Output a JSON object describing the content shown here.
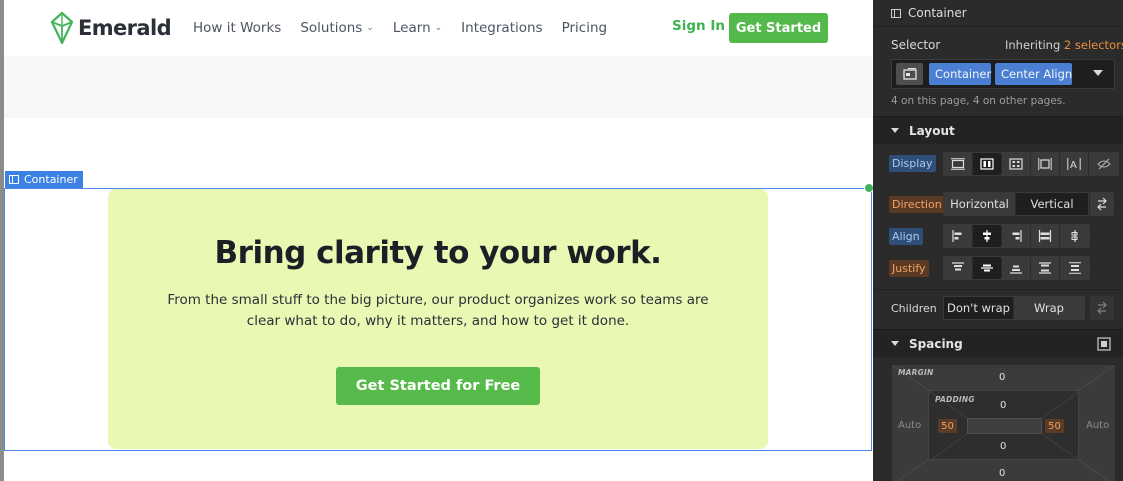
{
  "site": {
    "logo_text": "Emerald",
    "nav": [
      "How it Works",
      "Solutions",
      "Learn",
      "Integrations",
      "Pricing"
    ],
    "nav_has_dropdown": [
      false,
      true,
      true,
      false,
      false
    ],
    "sign_in": "Sign In",
    "get_started": "Get Started",
    "selection_tag": "Container",
    "hero": {
      "title": "Bring clarity to your work.",
      "subtitle": "From the small stuff to the big picture, our product organizes work so teams are clear what to do, why it matters, and how to get it done.",
      "cta": "Get Started for Free"
    }
  },
  "panel": {
    "header": "Container",
    "selector_label": "Selector",
    "inheriting_prefix": "Inheriting",
    "inheriting_link": "2 selectors",
    "chips": [
      "Container",
      "Center Align"
    ],
    "usage_note": "4 on this page, 4 on other pages.",
    "layout": {
      "title": "Layout",
      "display_label": "Display",
      "direction_label": "Direction",
      "direction_options": [
        "Horizontal",
        "Vertical"
      ],
      "align_label": "Align",
      "justify_label": "Justify",
      "children_label": "Children",
      "children_options": [
        "Don't wrap",
        "Wrap"
      ]
    },
    "spacing": {
      "title": "Spacing",
      "margin_label": "MARGIN",
      "padding_label": "PADDING",
      "margin_top": "0",
      "margin_bottom": "0",
      "margin_left": "Auto",
      "margin_right": "Auto",
      "padding_top": "0",
      "padding_bottom": "0",
      "padding_left": "50",
      "padding_right": "50"
    }
  },
  "colors": {
    "brand_green": "#53b94a",
    "hero_bg": "#e9f9b3",
    "selection_blue": "#3b82e4",
    "panel_bg": "#2b2b2b",
    "inherit_orange": "#e88f3c"
  }
}
